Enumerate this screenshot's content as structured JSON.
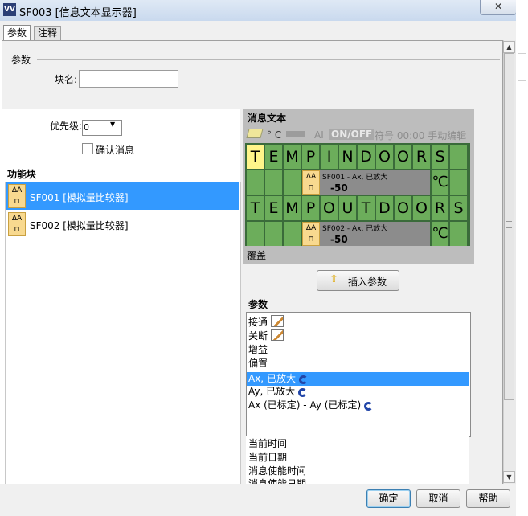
{
  "window": {
    "title": "SF003 [信息文本显示器]",
    "close_glyph": "✕",
    "icon_glyph": "VV"
  },
  "tabs": [
    {
      "label": "参数",
      "active": true
    },
    {
      "label": "注释",
      "active": false
    }
  ],
  "params_section": {
    "title": "参数",
    "block_name_label": "块名:",
    "block_name_value": ""
  },
  "priority": {
    "label": "优先级:",
    "value": "0"
  },
  "confirm_message": {
    "label": "确认消息",
    "checked": false
  },
  "function_blocks": {
    "title": "功能块",
    "items": [
      {
        "label": "SF001 [模拟量比较器]",
        "selected": true,
        "icon": "analog-compare-icon"
      },
      {
        "label": "SF002 [模拟量比较器]",
        "selected": false,
        "icon": "analog-compare-icon"
      }
    ]
  },
  "message_text": {
    "title": "消息文本",
    "toolbar": {
      "degc": "° C",
      "ai": "AI",
      "onoff": "ON/OFF",
      "rest": "符号 00:00 手动编辑"
    },
    "rows": [
      {
        "chars": [
          "T",
          "E",
          "M",
          "P",
          "I",
          "N",
          "D",
          "O",
          "O",
          "R",
          "S",
          ""
        ]
      },
      {
        "block": {
          "text": "SF001 - Ax, 已放大",
          "value": "-50",
          "suffix": "℃"
        }
      },
      {
        "chars": [
          "T",
          "E",
          "M",
          "P",
          "O",
          "U",
          "T",
          "D",
          "O",
          "O",
          "R",
          "S"
        ]
      },
      {
        "block": {
          "text": "SF002 - Ax, 已放大",
          "value": "-50",
          "suffix": "℃"
        }
      }
    ],
    "overlay_label": "覆盖"
  },
  "insert_button": {
    "label": "插入参数"
  },
  "param_list": {
    "title": "参数",
    "items": [
      {
        "label": "接通",
        "icon": "edit-icon"
      },
      {
        "label": "关断",
        "icon": "edit-icon"
      },
      {
        "label": "增益",
        "icon": ""
      },
      {
        "label": "偏置",
        "icon": ""
      },
      {
        "label": "Ax, 已放大",
        "icon": "refresh-icon",
        "selected": true
      },
      {
        "label": "Ay, 已放大",
        "icon": "refresh-icon"
      },
      {
        "label": "Ax (已标定) - Ay (已标定)",
        "icon": "refresh-icon"
      }
    ]
  },
  "time_list": {
    "items": [
      "当前时间",
      "当前日期",
      "消息使能时间",
      "消息使能日期"
    ]
  },
  "buttons": {
    "ok": "确定",
    "cancel": "取消",
    "help": "帮助"
  },
  "colors": {
    "selection": "#3399ff",
    "grid_cell": "#6cad5b",
    "param_block": "#8c8c8c",
    "block_icon": "#f8d98f"
  }
}
